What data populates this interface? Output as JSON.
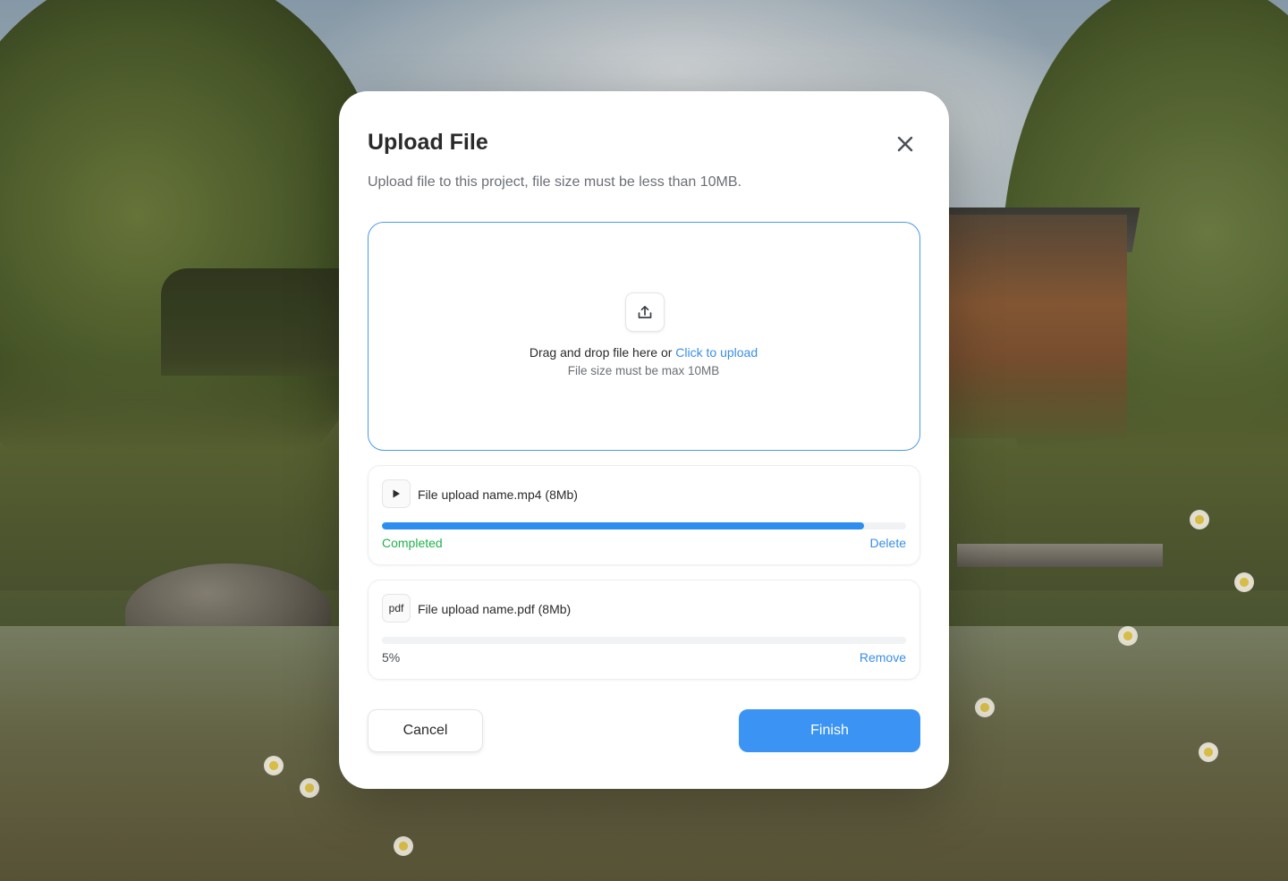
{
  "modal": {
    "title": "Upload File",
    "subtitle": "Upload file to this project, file size must be less than 10MB.",
    "close_icon": "close-icon"
  },
  "dropzone": {
    "icon": "upload-icon",
    "prompt": "Drag and drop file here or ",
    "link": "Click to upload",
    "hint": "File size must be max 10MB"
  },
  "files": [
    {
      "icon": "play-icon",
      "name": "File upload name.mp4 (8Mb)",
      "progress_percent": 92,
      "status": "Completed",
      "status_color": "#22b14c",
      "action": "Delete"
    },
    {
      "icon_label": "pdf",
      "name": "File upload name.pdf (8Mb)",
      "progress_percent": 5,
      "status": "5%",
      "status_color": "#4a4f57",
      "action": "Remove"
    }
  ],
  "footer": {
    "cancel_label": "Cancel",
    "finish_label": "Finish"
  },
  "colors": {
    "accent": "#3b94f3",
    "link": "#3a8ee6",
    "success": "#22b14c"
  }
}
